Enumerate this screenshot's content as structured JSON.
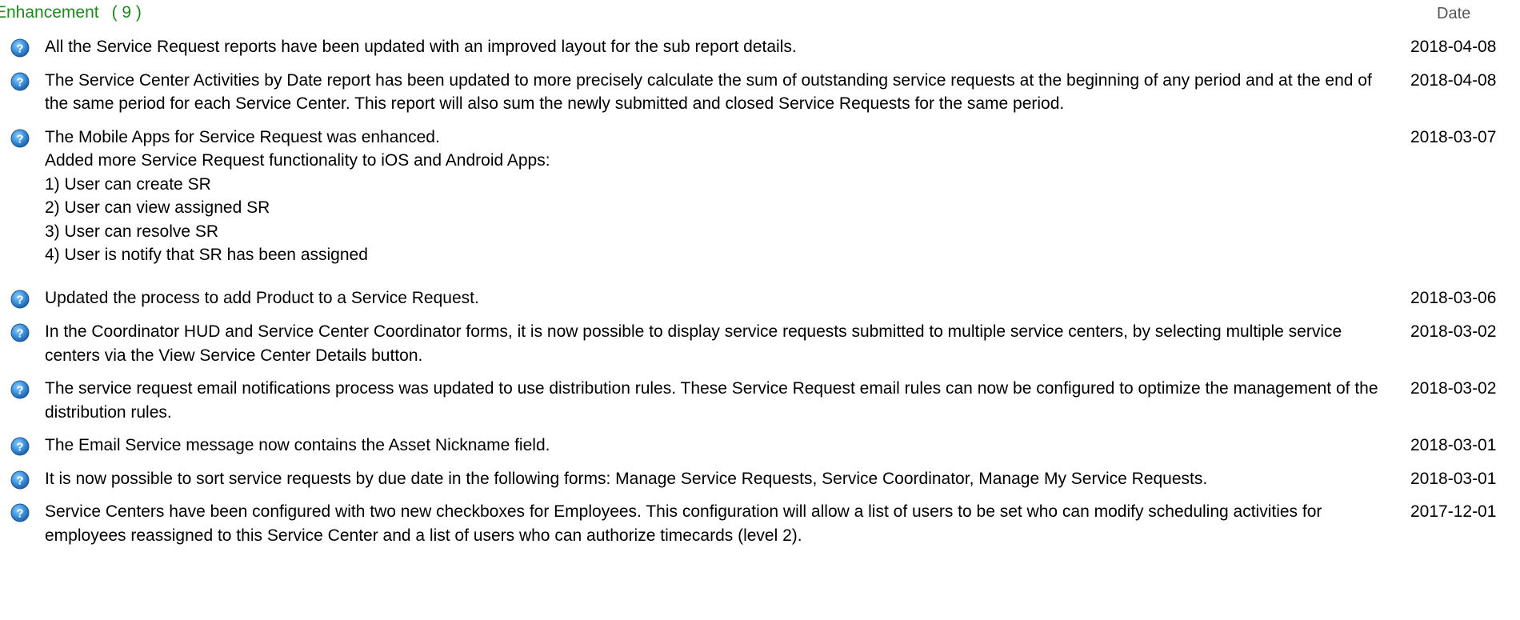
{
  "section": {
    "title": "Enhancement",
    "count": "( 9 )",
    "date_column": "Date",
    "title_color": "#1a8c1a"
  },
  "icon": {
    "name": "help-question-icon",
    "color": "#3a8ed8"
  },
  "items": [
    {
      "description": "All the Service Request reports have been updated with an improved layout for the sub report details.",
      "date": "2018-04-08"
    },
    {
      "description": "The Service Center Activities by Date report has been updated to more precisely calculate the sum of outstanding service requests at the beginning of any period and at the end of the same period for each Service Center. This report will also sum the newly submitted and closed Service Requests for the same period.",
      "date": "2018-04-08"
    },
    {
      "description": "The Mobile Apps for Service Request was enhanced.\nAdded more Service Request functionality to iOS and Android Apps:\n1) User can create SR\n2) User can view assigned SR\n3) User can resolve SR\n4) User is notify that SR has been assigned",
      "date": "2018-03-07"
    },
    {
      "description": "Updated the process to add Product to a Service Request.",
      "date": "2018-03-06"
    },
    {
      "description": "In the Coordinator HUD and Service Center Coordinator forms, it is now possible to display service requests submitted to multiple service centers, by selecting multiple service centers via the View Service Center Details button.",
      "date": "2018-03-02"
    },
    {
      "description": "The service request email notifications process was updated to use distribution rules. These Service Request email rules can now be configured to optimize the management of the distribution rules.",
      "date": "2018-03-02"
    },
    {
      "description": "The Email Service message now contains the Asset Nickname field.",
      "date": "2018-03-01"
    },
    {
      "description": "It is now possible to sort service requests by due date in the following forms: Manage Service Requests, Service Coordinator, Manage My Service Requests.",
      "date": "2018-03-01"
    },
    {
      "description": "Service Centers have been configured with two new checkboxes for Employees. This configuration will allow a list of users to be set who can modify scheduling activities for employees reassigned to this Service Center and a list of users who can authorize timecards (level 2).",
      "date": "2017-12-01"
    }
  ]
}
